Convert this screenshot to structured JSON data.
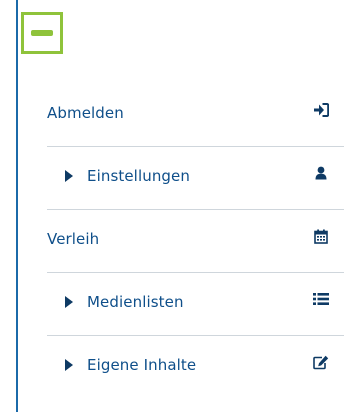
{
  "menu": {
    "items": [
      {
        "label": "Abmelden",
        "icon": "sign-in-icon",
        "has_submenu": false
      },
      {
        "label": "Einstellungen",
        "icon": "user-icon",
        "has_submenu": true
      },
      {
        "label": "Verleih",
        "icon": "calendar-icon",
        "has_submenu": false
      },
      {
        "label": "Medienlisten",
        "icon": "list-icon",
        "has_submenu": true
      },
      {
        "label": "Eigene Inhalte",
        "icon": "edit-icon",
        "has_submenu": true
      }
    ]
  },
  "colors": {
    "accent_green": "#8fc33b",
    "link_blue": "#0f4f8a",
    "icon_dark": "#0e3a64",
    "divider": "#cfd6dc",
    "panel_border": "#1b6aa9"
  }
}
